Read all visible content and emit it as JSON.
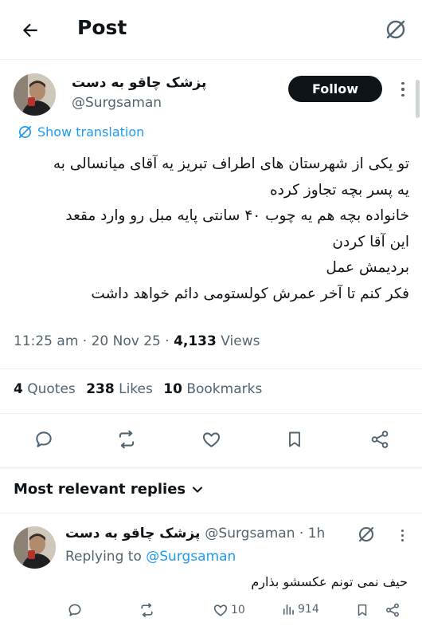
{
  "header": {
    "title": "Post"
  },
  "post": {
    "author_name": "پزشک چاقو به دست",
    "handle": "@Surgsaman",
    "follow_label": "Follow",
    "translate_label": "Show translation",
    "text_lines": [
      "تو یکی از شهرستان های اطراف تبریز یه آقای میانسالی به",
      "یه پسر بچه تجاوز کرده",
      "خانواده بچه هم یه چوب ۴۰ سانتی پایه مبل رو وارد مقعد",
      "این آقا کردن",
      "بردیمش عمل",
      "فکر کنم تا آخر عمرش کولستومی دائم خواهد داشت"
    ],
    "time": "11:25 am",
    "date": "20 Nov 25",
    "views_count": "4,133",
    "views_label": "Views",
    "quotes_count": "4",
    "quotes_label": "Quotes",
    "likes_count": "238",
    "likes_label": "Likes",
    "bookmarks_count": "10",
    "bookmarks_label": "Bookmarks"
  },
  "replies": {
    "header": "Most relevant replies",
    "items": [
      {
        "author_name": "پزشک چاقو به دست",
        "handle": "@Surgsaman",
        "time": "1h",
        "replying_label": "Replying to",
        "replying_handle": "@Surgsaman",
        "text": "حیف نمی تونم عکسشو بذارم",
        "likes": "10",
        "views": "914"
      }
    ]
  },
  "icons": {
    "back": "arrow-left-icon",
    "grok": "grok-icon",
    "more": "more-vertical-icon",
    "translate": "globe-icon",
    "reply": "reply-icon",
    "repost": "repost-icon",
    "like": "heart-icon",
    "bookmark": "bookmark-icon",
    "share": "share-icon",
    "views": "views-chart-icon",
    "chevron": "chevron-down-icon"
  },
  "colors": {
    "accent": "#1d9bf0",
    "text": "#0f1419",
    "secondary": "#536471",
    "follow_bg": "#0f1419"
  }
}
